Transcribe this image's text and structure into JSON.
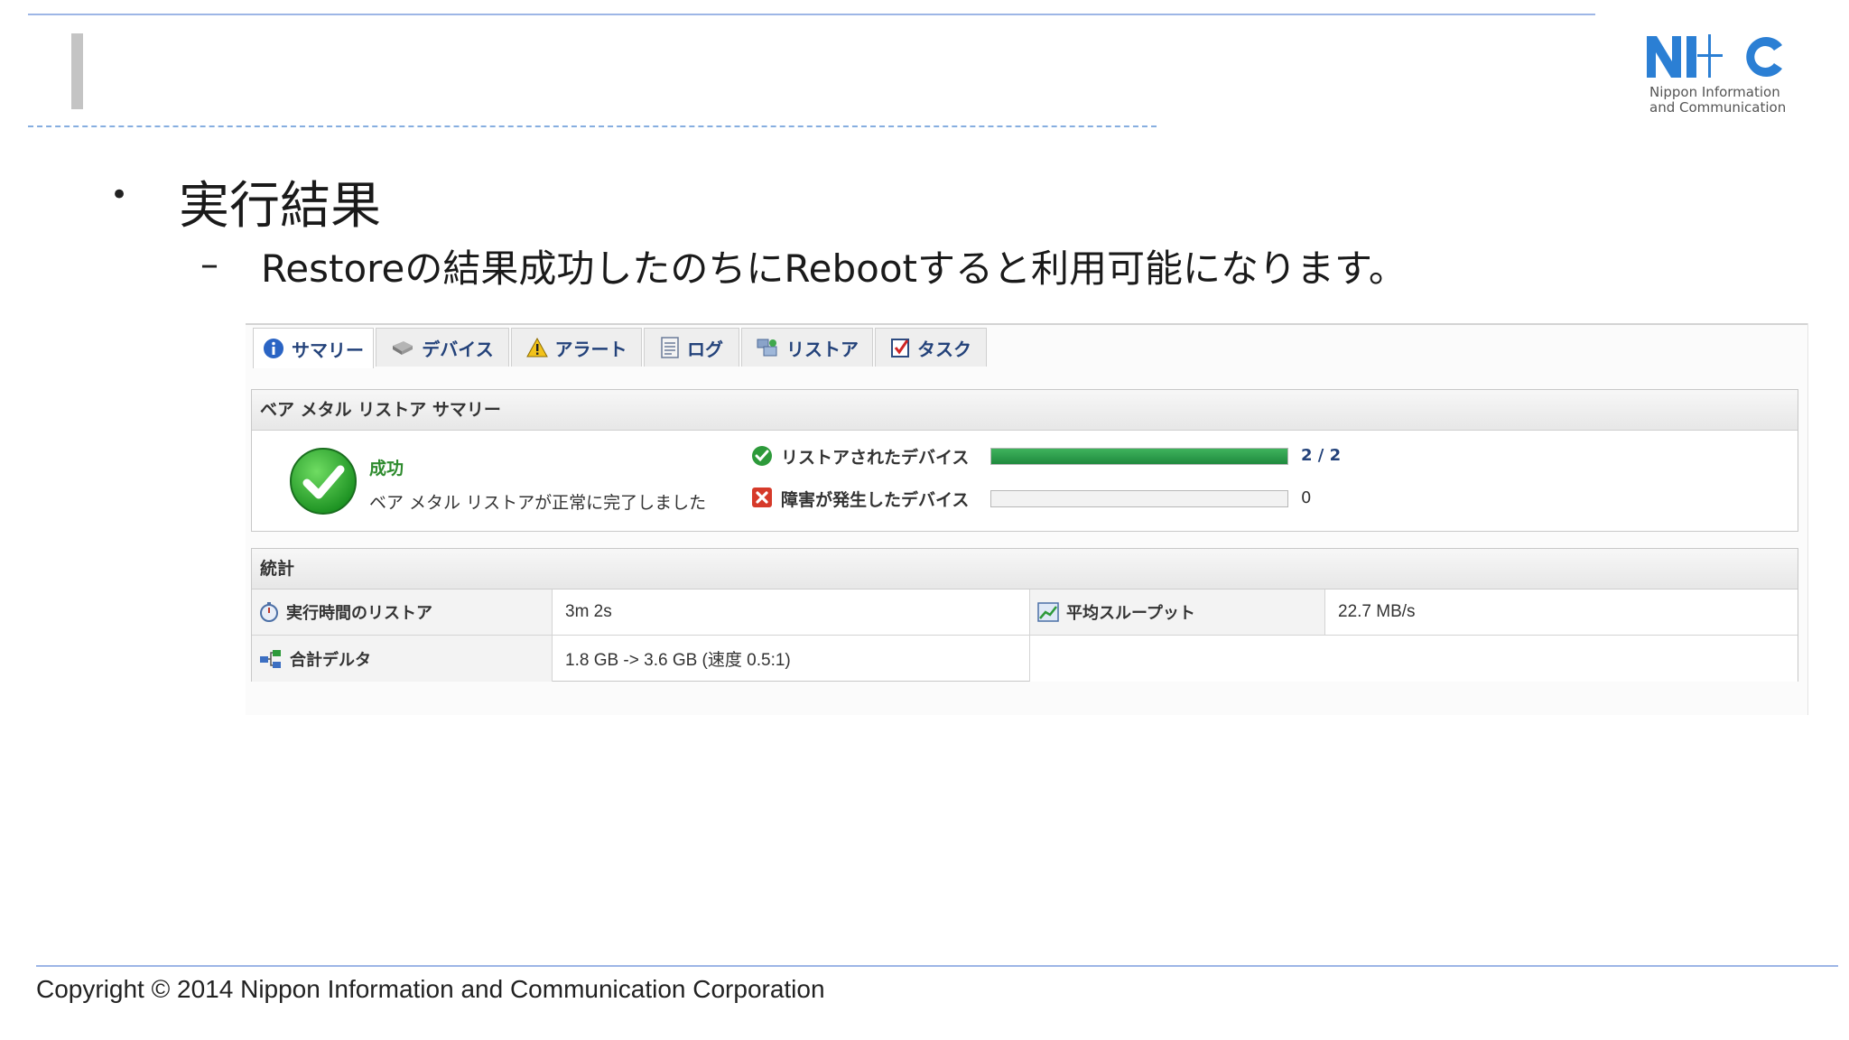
{
  "slide": {
    "heading": "実行結果",
    "subheading": "Restoreの結果成功したのちにRebootすると利用可能になります。",
    "copyright": "Copyright © 2014 Nippon Information and Communication Corporation",
    "logo": {
      "mark": "NI+C",
      "line1": "Nippon Information",
      "line2": "and Communication"
    }
  },
  "tabs": [
    {
      "label": "サマリー",
      "icon": "info-icon"
    },
    {
      "label": "デバイス",
      "icon": "disk-icon"
    },
    {
      "label": "アラート",
      "icon": "warning-icon"
    },
    {
      "label": "ログ",
      "icon": "log-icon"
    },
    {
      "label": "リストア",
      "icon": "restore-icon"
    },
    {
      "label": "タスク",
      "icon": "task-icon"
    }
  ],
  "summary": {
    "title": "ベア メタル リストア サマリー",
    "status": "成功",
    "status_desc": "ベア メタル リストアが正常に完了しました",
    "restored_label": "リストアされたデバイス",
    "restored_value": "2 / 2",
    "restored_fraction": 1.0,
    "failed_label": "障害が発生したデバイス",
    "failed_value": "0",
    "failed_fraction": 0.0
  },
  "stats": {
    "title": "統計",
    "elapsed_label": "実行時間のリストア",
    "elapsed_value": "3m 2s",
    "throughput_label": "平均スループット",
    "throughput_value": "22.7 MB/s",
    "delta_label": "合計デルタ",
    "delta_value": "1.8 GB -> 3.6 GB (速度 0.5:1)"
  },
  "colors": {
    "accent": "#23427a",
    "success": "#2e8b2e",
    "error": "#d63a2a"
  }
}
